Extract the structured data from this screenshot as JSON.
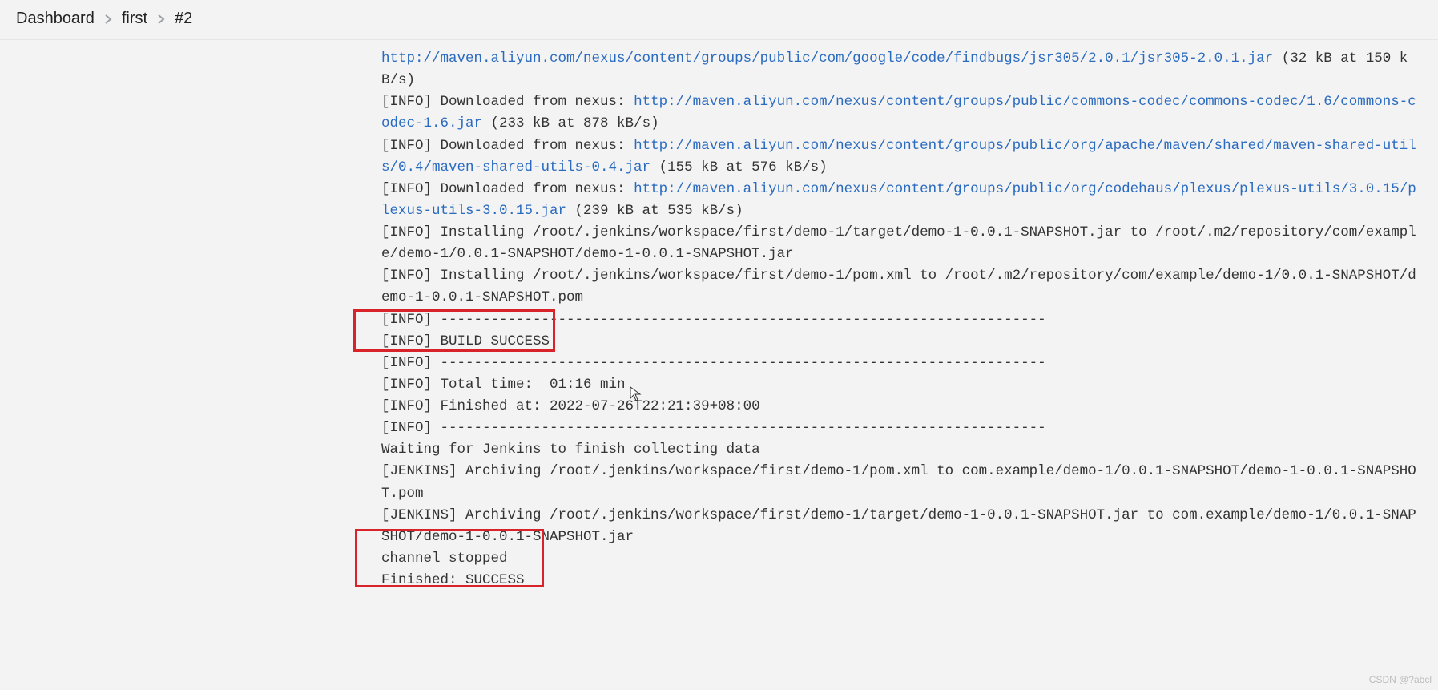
{
  "breadcrumb": {
    "dashboard": "Dashboard",
    "project": "first",
    "build": "#2"
  },
  "console": {
    "url1": "http://maven.aliyun.com/nexus/content/groups/public/com/google/code/findbugs/jsr305/2.0.1/jsr305-2.0.1.jar",
    "suffix1": " (32 kB at 150 kB/s)",
    "prefix2": "[INFO] Downloaded from nexus: ",
    "url2": "http://maven.aliyun.com/nexus/content/groups/public/commons-codec/commons-codec/1.6/commons-codec-1.6.jar",
    "suffix2": " (233 kB at 878 kB/s)",
    "prefix3": "[INFO] Downloaded from nexus: ",
    "url3": "http://maven.aliyun.com/nexus/content/groups/public/org/apache/maven/shared/maven-shared-utils/0.4/maven-shared-utils-0.4.jar",
    "suffix3": " (155 kB at 576 kB/s)",
    "prefix4": "[INFO] Downloaded from nexus: ",
    "url4": "http://maven.aliyun.com/nexus/content/groups/public/org/codehaus/plexus/plexus-utils/3.0.15/plexus-utils-3.0.15.jar",
    "suffix4": " (239 kB at 535 kB/s)",
    "install1": "[INFO] Installing /root/.jenkins/workspace/first/demo-1/target/demo-1-0.0.1-SNAPSHOT.jar to /root/.m2/repository/com/example/demo-1/0.0.1-SNAPSHOT/demo-1-0.0.1-SNAPSHOT.jar",
    "install2": "[INFO] Installing /root/.jenkins/workspace/first/demo-1/pom.xml to /root/.m2/repository/com/example/demo-1/0.0.1-SNAPSHOT/demo-1-0.0.1-SNAPSHOT.pom",
    "sep1": "[INFO] ------------------------------------------------------------------------",
    "build_success": "[INFO] BUILD SUCCESS",
    "sep2": "[INFO] ------------------------------------------------------------------------",
    "total_time": "[INFO] Total time:  01:16 min",
    "finished_at": "[INFO] Finished at: 2022-07-26T22:21:39+08:00",
    "sep3": "[INFO] ------------------------------------------------------------------------",
    "waiting": "Waiting for Jenkins to finish collecting data",
    "archiving1": "[JENKINS] Archiving /root/.jenkins/workspace/first/demo-1/pom.xml to com.example/demo-1/0.0.1-SNAPSHOT/demo-1-0.0.1-SNAPSHOT.pom",
    "archiving2": "[JENKINS] Archiving /root/.jenkins/workspace/first/demo-1/target/demo-1-0.0.1-SNAPSHOT.jar to com.example/demo-1/0.0.1-SNAPSHOT/demo-1-0.0.1-SNAPSHOT.jar",
    "channel_stopped": "channel stopped",
    "finished": "Finished: SUCCESS"
  },
  "watermark": "CSDN @?abcl"
}
